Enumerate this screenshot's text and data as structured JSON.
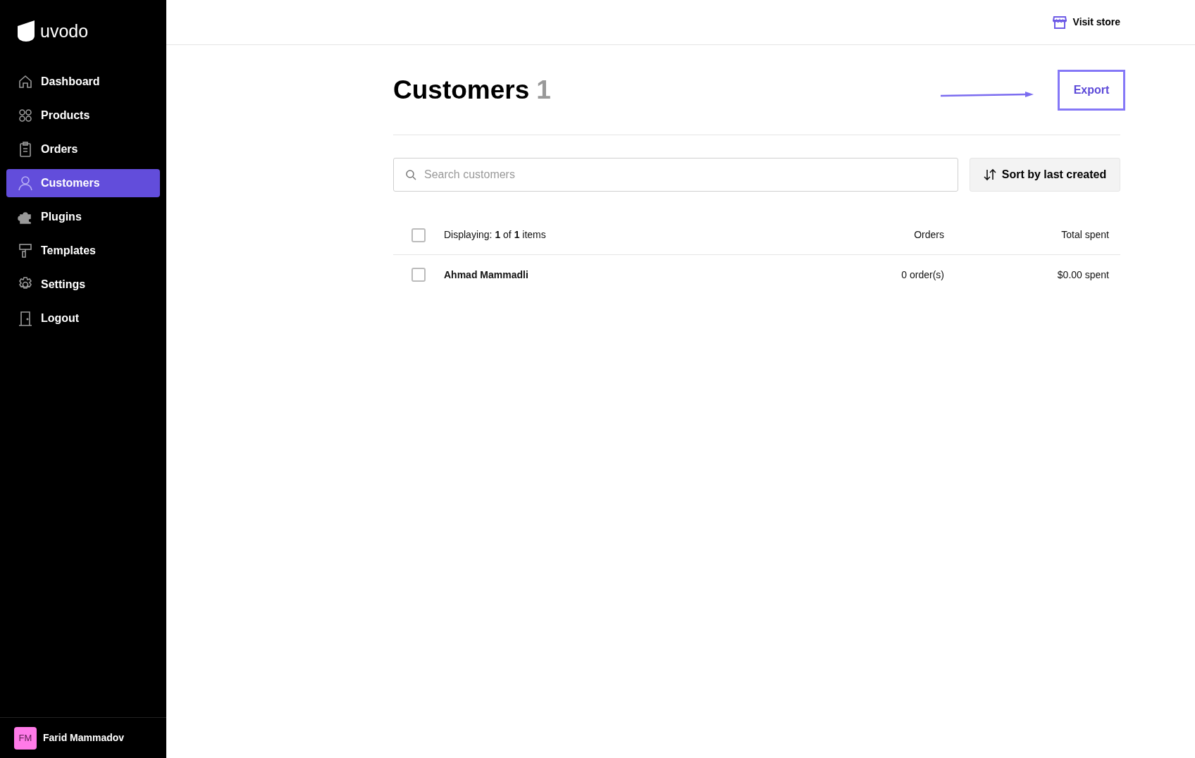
{
  "brand": "uvodo",
  "sidebar": {
    "items": [
      {
        "label": "Dashboard",
        "kind": "home",
        "selected": false
      },
      {
        "label": "Products",
        "kind": "grid",
        "selected": false
      },
      {
        "label": "Orders",
        "kind": "clipboard",
        "selected": false
      },
      {
        "label": "Customers",
        "kind": "user",
        "selected": true
      },
      {
        "label": "Plugins",
        "kind": "puzzle",
        "selected": false
      },
      {
        "label": "Templates",
        "kind": "brush",
        "selected": false
      },
      {
        "label": "Settings",
        "kind": "gear",
        "selected": false
      },
      {
        "label": "Logout",
        "kind": "door",
        "selected": false
      }
    ],
    "user": {
      "initials": "FM",
      "name": "Farid Mammadov"
    }
  },
  "topbar": {
    "link": "Visit store"
  },
  "page": {
    "title": "Customers",
    "count": "1",
    "export_button": "Export"
  },
  "search": {
    "placeholder": "Search customers"
  },
  "sort_button": "Sort by last created",
  "table": {
    "summary": "Displaying: **1** of **1** items",
    "columns": [
      "Orders",
      "Total spent"
    ],
    "all_checked": false,
    "rows": [
      {
        "name": "Ahmad Mammadli",
        "orders": "0 order(s)",
        "total": "$0.00 spent",
        "checked": false
      }
    ]
  }
}
